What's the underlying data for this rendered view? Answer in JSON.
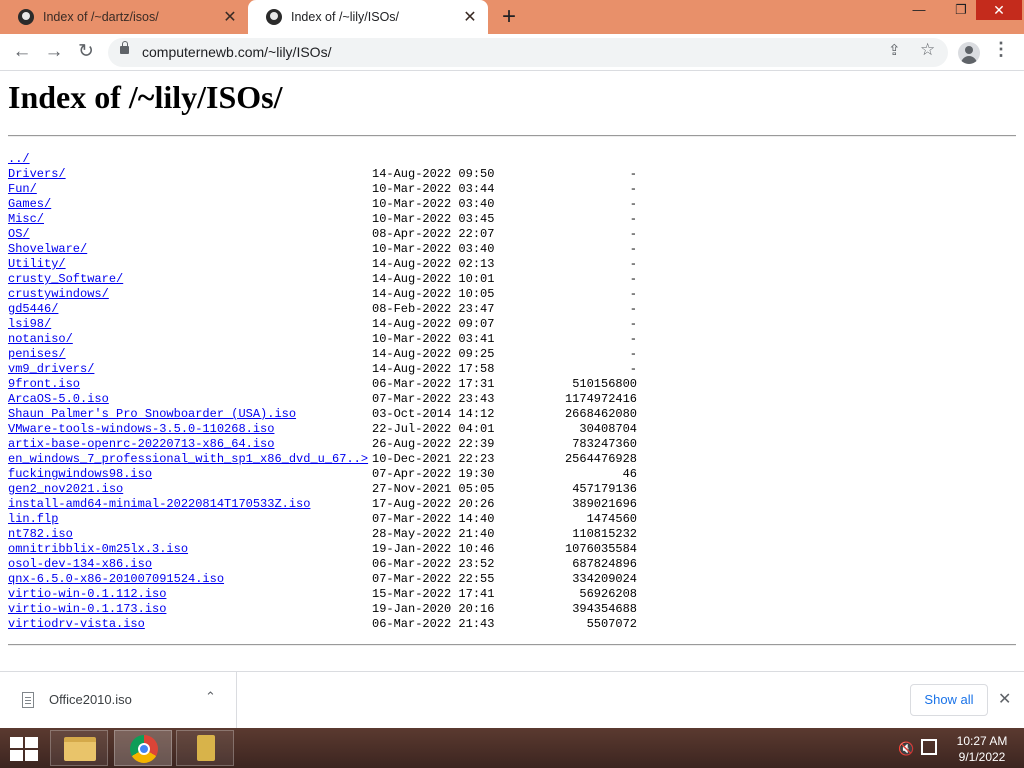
{
  "browser": {
    "tabs": [
      {
        "title": "Index of /~dartz/isos/",
        "close": "✕"
      },
      {
        "title": "Index of /~lily/ISOs/",
        "close": "✕"
      }
    ],
    "new_tab": "+",
    "window_controls": {
      "minimize": "—",
      "maximize": "❐",
      "close": "✕"
    },
    "nav": {
      "back": "←",
      "forward": "→",
      "reload": "↻"
    },
    "url": "computernewb.com/~lily/ISOs/",
    "icons": {
      "share": "⇪",
      "star": "☆",
      "menu": "⋮"
    }
  },
  "page": {
    "heading": "Index of /~lily/ISOs/",
    "entries": [
      {
        "name": "../",
        "date": "",
        "size": ""
      },
      {
        "name": "Drivers/",
        "date": "14-Aug-2022 09:50",
        "size": "-"
      },
      {
        "name": "Fun/",
        "date": "10-Mar-2022 03:44",
        "size": "-"
      },
      {
        "name": "Games/",
        "date": "10-Mar-2022 03:40",
        "size": "-"
      },
      {
        "name": "Misc/",
        "date": "10-Mar-2022 03:45",
        "size": "-"
      },
      {
        "name": "OS/",
        "date": "08-Apr-2022 22:07",
        "size": "-"
      },
      {
        "name": "Shovelware/",
        "date": "10-Mar-2022 03:40",
        "size": "-"
      },
      {
        "name": "Utility/",
        "date": "14-Aug-2022 02:13",
        "size": "-"
      },
      {
        "name": "crusty_Software/",
        "date": "14-Aug-2022 10:01",
        "size": "-"
      },
      {
        "name": "crustywindows/",
        "date": "14-Aug-2022 10:05",
        "size": "-"
      },
      {
        "name": "gd5446/",
        "date": "08-Feb-2022 23:47",
        "size": "-"
      },
      {
        "name": "lsi98/",
        "date": "14-Aug-2022 09:07",
        "size": "-"
      },
      {
        "name": "notaniso/",
        "date": "10-Mar-2022 03:41",
        "size": "-"
      },
      {
        "name": "penises/",
        "date": "14-Aug-2022 09:25",
        "size": "-"
      },
      {
        "name": "vm9_drivers/",
        "date": "14-Aug-2022 17:58",
        "size": "-"
      },
      {
        "name": "9front.iso",
        "date": "06-Mar-2022 17:31",
        "size": "510156800"
      },
      {
        "name": "ArcaOS-5.0.iso",
        "date": "07-Mar-2022 23:43",
        "size": "1174972416"
      },
      {
        "name": "Shaun Palmer's Pro Snowboarder (USA).iso",
        "date": "03-Oct-2014 14:12",
        "size": "2668462080"
      },
      {
        "name": "VMware-tools-windows-3.5.0-110268.iso",
        "date": "22-Jul-2022 04:01",
        "size": "30408704"
      },
      {
        "name": "artix-base-openrc-20220713-x86_64.iso",
        "date": "26-Aug-2022 22:39",
        "size": "783247360"
      },
      {
        "name": "en_windows_7_professional_with_sp1_x86_dvd_u_67..>",
        "date": "10-Dec-2021 22:23",
        "size": "2564476928"
      },
      {
        "name": "fuckingwindows98.iso",
        "date": "07-Apr-2022 19:30",
        "size": "46"
      },
      {
        "name": "gen2_nov2021.iso",
        "date": "27-Nov-2021 05:05",
        "size": "457179136"
      },
      {
        "name": "install-amd64-minimal-20220814T170533Z.iso",
        "date": "17-Aug-2022 20:26",
        "size": "389021696"
      },
      {
        "name": "lin.flp",
        "date": "07-Mar-2022 14:40",
        "size": "1474560"
      },
      {
        "name": "nt782.iso",
        "date": "28-May-2022 21:40",
        "size": "110815232"
      },
      {
        "name": "omnitribblix-0m25lx.3.iso",
        "date": "19-Jan-2022 10:46",
        "size": "1076035584"
      },
      {
        "name": "osol-dev-134-x86.iso",
        "date": "06-Mar-2022 23:52",
        "size": "687824896"
      },
      {
        "name": "qnx-6.5.0-x86-201007091524.iso",
        "date": "07-Mar-2022 22:55",
        "size": "334209024"
      },
      {
        "name": "virtio-win-0.1.112.iso",
        "date": "15-Mar-2022 17:41",
        "size": "56926208"
      },
      {
        "name": "virtio-win-0.1.173.iso",
        "date": "19-Jan-2020 20:16",
        "size": "394354688"
      },
      {
        "name": "virtiodrv-vista.iso",
        "date": "06-Mar-2022 21:43",
        "size": "5507072"
      }
    ]
  },
  "download_shelf": {
    "file_name": "Office2010.iso",
    "chevron": "⌃",
    "show_all": "Show all",
    "close": "✕"
  },
  "taskbar": {
    "speaker": "🔇",
    "time": "10:27 AM",
    "date": "9/1/2022"
  },
  "colors": {
    "tabstrip": "#e8906a",
    "link": "#0000ee",
    "taskbar": "#4a2e27",
    "close_button": "#c42b1c"
  }
}
